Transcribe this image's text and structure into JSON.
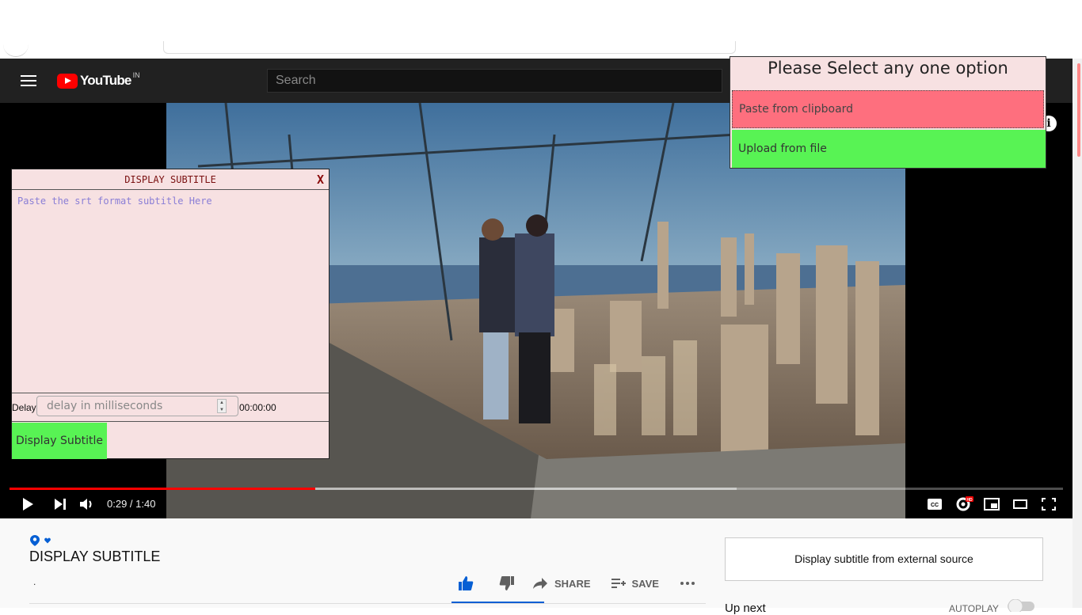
{
  "header": {
    "logo_text": "YouTube",
    "region": "IN",
    "search_placeholder": "Search"
  },
  "player": {
    "current_time": "0:29",
    "duration": "1:40",
    "time_display": "0:29 / 1:40",
    "played_fraction": 0.29,
    "buffered_fraction": 0.69
  },
  "subtitle_panel": {
    "title": "DISPLAY SUBTITLE",
    "close_label": "X",
    "textarea_placeholder": "Paste the srt format subtitle Here",
    "delay_label": "Delay",
    "delay_placeholder": "delay in milliseconds",
    "delay_time": "00:00:00",
    "display_button": "Display Subtitle"
  },
  "option_popup": {
    "title": "Please Select any one option",
    "paste_option": "Paste from clipboard",
    "upload_option": "Upload from file"
  },
  "video_info": {
    "title": "DISPLAY SUBTITLE",
    "dot": ".",
    "share_label": "SHARE",
    "save_label": "SAVE",
    "external_button": "Display subtitle from external source",
    "up_next": "Up next",
    "autoplay": "AUTOPLAY"
  },
  "colors": {
    "red": "#ff0000",
    "green_button": "#58f354",
    "pink_button": "#fe6f7e",
    "panel_bg": "#f7e1e2",
    "like_blue": "#065fd4"
  }
}
